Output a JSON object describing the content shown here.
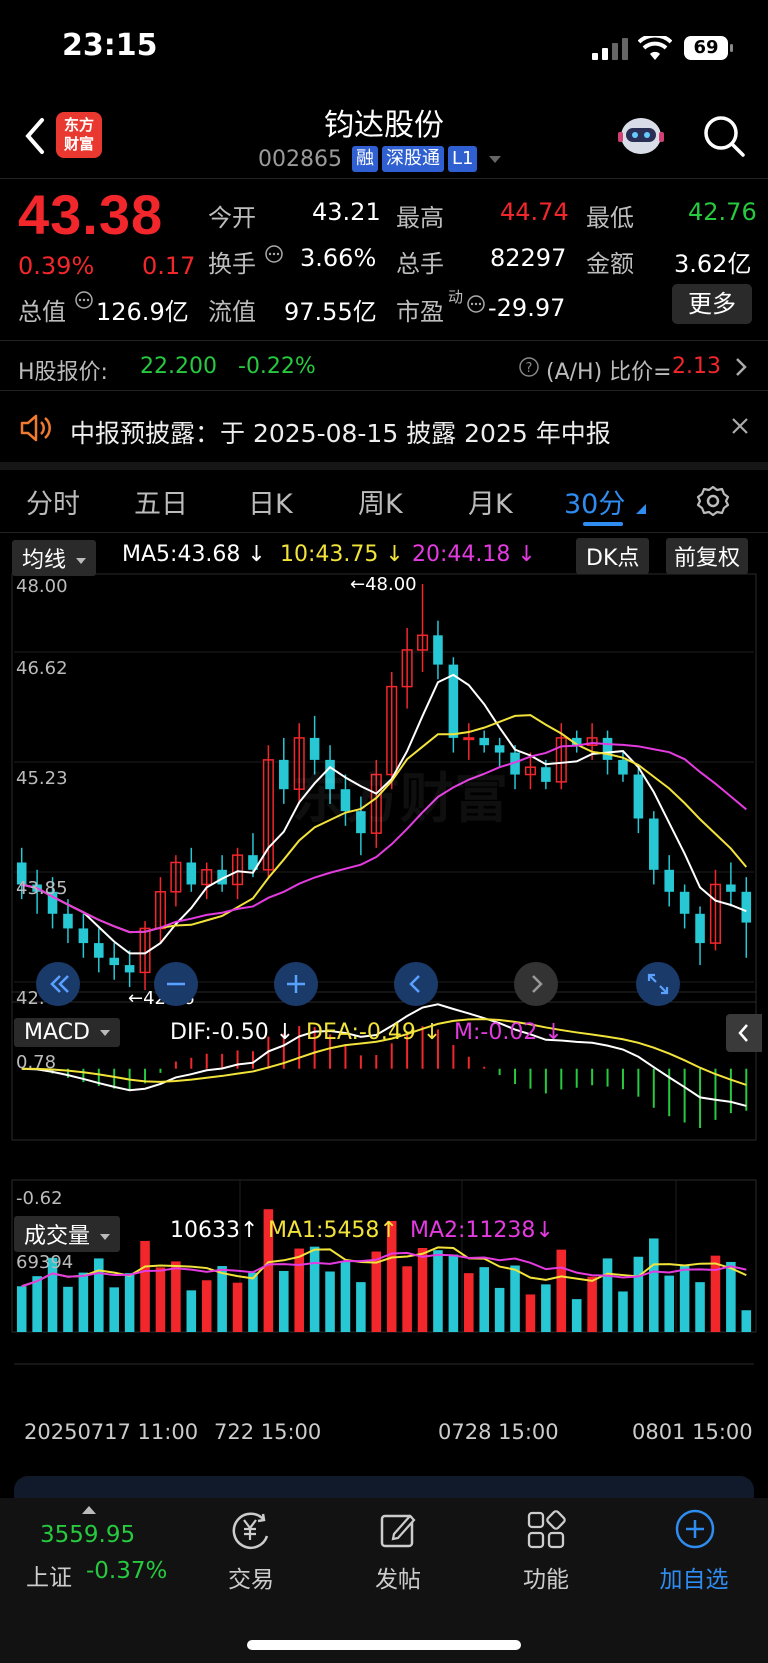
{
  "status": {
    "time": "23:15",
    "battery": "69"
  },
  "header": {
    "title": "钧达股份",
    "code": "002865",
    "tags": [
      "融",
      "深股通",
      "L1"
    ],
    "logo_line1": "东方",
    "logo_line2": "财富"
  },
  "quote": {
    "price": "43.38",
    "change_pct": "0.39%",
    "change": "0.17",
    "open_label": "今开",
    "open": "43.21",
    "high_label": "最高",
    "high": "44.74",
    "low_label": "最低",
    "low": "42.76",
    "turnover_label": "换手",
    "turnover": "3.66%",
    "volume_label": "总手",
    "volume": "82297",
    "amount_label": "金额",
    "amount": "3.62亿",
    "mktcap_label": "总值",
    "mktcap": "126.9亿",
    "float_label": "流值",
    "float": "97.55亿",
    "pe_label": "市盈",
    "pe_sup": "动",
    "pe": "-29.97",
    "more": "更多"
  },
  "hshare": {
    "label": "H股报价:",
    "price": "22.200",
    "change": "-0.22%",
    "ratio_label": "(A/H) 比价=",
    "ratio": "2.13"
  },
  "notice": {
    "text": "中报预披露：于 2025-08-15 披露 2025 年中报"
  },
  "tabs": [
    "分时",
    "五日",
    "日K",
    "周K",
    "月K",
    "30分"
  ],
  "active_tab": "30分",
  "kline": {
    "indicator": "均线",
    "ma5": "MA5:43.68",
    "ma10": "10:43.75",
    "ma20": "20:44.18",
    "dk": "DK点",
    "adjust": "前复权",
    "y_labels": [
      "48.00",
      "46.62",
      "45.23",
      "43.85",
      "42.46"
    ],
    "max_label": "←48.00",
    "min_label": "←42.46",
    "watermark": "东方财富"
  },
  "macd": {
    "label": "MACD",
    "dif": "DIF:-0.50",
    "dea": "DEA:-0.49",
    "m": "M:-0.02",
    "y_top": "0.78",
    "y_bottom": "-0.62"
  },
  "volume_panel": {
    "label": "成交量",
    "vol": "10633",
    "ma1": "MA1:5458",
    "ma2": "MA2:11238",
    "y_top": "69394"
  },
  "x_labels": [
    "20250717 11:00",
    "722 15:00",
    "0728 15:00",
    "0801 15:00"
  ],
  "arrows": {
    "up": "↑",
    "down": "↓"
  },
  "bottom": {
    "index_value": "3559.95",
    "index_name": "上证",
    "index_change": "-0.37%",
    "nav": [
      "交易",
      "发帖",
      "功能",
      "加自选"
    ]
  },
  "colors": {
    "up": "#f2272c",
    "down": "#27c7d4",
    "ma5": "#ffffff",
    "ma10": "#f2e33b",
    "ma20": "#e33be0",
    "accent": "#2f8cf0"
  },
  "chart_data": {
    "type": "candlestick",
    "interval": "30分",
    "price_range": [
      42.46,
      48.0
    ],
    "candles": [
      [
        44.2,
        44.4,
        43.7,
        43.9
      ],
      [
        43.9,
        44.1,
        43.5,
        43.8
      ],
      [
        43.8,
        44.0,
        43.3,
        43.5
      ],
      [
        43.5,
        43.7,
        43.1,
        43.3
      ],
      [
        43.3,
        43.5,
        42.9,
        43.1
      ],
      [
        43.1,
        43.3,
        42.7,
        42.9
      ],
      [
        42.9,
        43.1,
        42.6,
        42.8
      ],
      [
        42.8,
        43.0,
        42.5,
        42.7
      ],
      [
        42.7,
        43.4,
        42.46,
        43.3
      ],
      [
        43.3,
        44.0,
        43.1,
        43.8
      ],
      [
        43.8,
        44.3,
        43.6,
        44.2
      ],
      [
        44.2,
        44.4,
        43.8,
        43.9
      ],
      [
        43.9,
        44.2,
        43.7,
        44.1
      ],
      [
        44.1,
        44.3,
        43.8,
        43.9
      ],
      [
        43.9,
        44.4,
        43.7,
        44.3
      ],
      [
        44.3,
        44.6,
        44.0,
        44.1
      ],
      [
        44.1,
        45.8,
        44.0,
        45.6
      ],
      [
        45.6,
        45.9,
        45.0,
        45.2
      ],
      [
        45.2,
        46.1,
        45.0,
        45.9
      ],
      [
        45.9,
        46.2,
        45.4,
        45.6
      ],
      [
        45.6,
        45.8,
        45.0,
        45.2
      ],
      [
        45.2,
        45.4,
        44.7,
        44.9
      ],
      [
        44.9,
        45.1,
        44.3,
        44.6
      ],
      [
        44.6,
        45.6,
        44.4,
        45.4
      ],
      [
        45.4,
        46.8,
        45.2,
        46.6
      ],
      [
        46.6,
        47.4,
        46.3,
        47.1
      ],
      [
        47.1,
        48.0,
        46.8,
        47.3
      ],
      [
        47.3,
        47.5,
        46.7,
        46.9
      ],
      [
        46.9,
        47.0,
        45.7,
        45.9
      ],
      [
        45.9,
        46.1,
        45.6,
        45.9
      ],
      [
        45.9,
        46.0,
        45.7,
        45.8
      ],
      [
        45.8,
        45.9,
        45.5,
        45.7
      ],
      [
        45.7,
        45.8,
        45.2,
        45.4
      ],
      [
        45.4,
        45.7,
        45.2,
        45.5
      ],
      [
        45.5,
        45.6,
        45.2,
        45.3
      ],
      [
        45.3,
        46.1,
        45.2,
        45.9
      ],
      [
        45.9,
        46.0,
        45.7,
        45.8
      ],
      [
        45.8,
        46.1,
        45.6,
        45.9
      ],
      [
        45.9,
        46.0,
        45.4,
        45.6
      ],
      [
        45.6,
        45.7,
        45.3,
        45.4
      ],
      [
        45.4,
        45.5,
        44.6,
        44.8
      ],
      [
        44.8,
        44.9,
        43.9,
        44.1
      ],
      [
        44.1,
        44.3,
        43.6,
        43.8
      ],
      [
        43.8,
        43.9,
        43.3,
        43.5
      ],
      [
        43.5,
        43.6,
        42.8,
        43.1
      ],
      [
        43.1,
        44.1,
        43.0,
        43.9
      ],
      [
        43.9,
        44.2,
        43.6,
        43.8
      ],
      [
        43.8,
        44.0,
        42.9,
        43.38
      ]
    ],
    "macd": {
      "y_range": [
        -0.62,
        0.78
      ],
      "dif": -0.5,
      "dea": -0.49,
      "m": -0.02
    },
    "volume": {
      "y_max": 69394,
      "last": 10633,
      "ma1": 5458,
      "ma2": 11238
    }
  }
}
